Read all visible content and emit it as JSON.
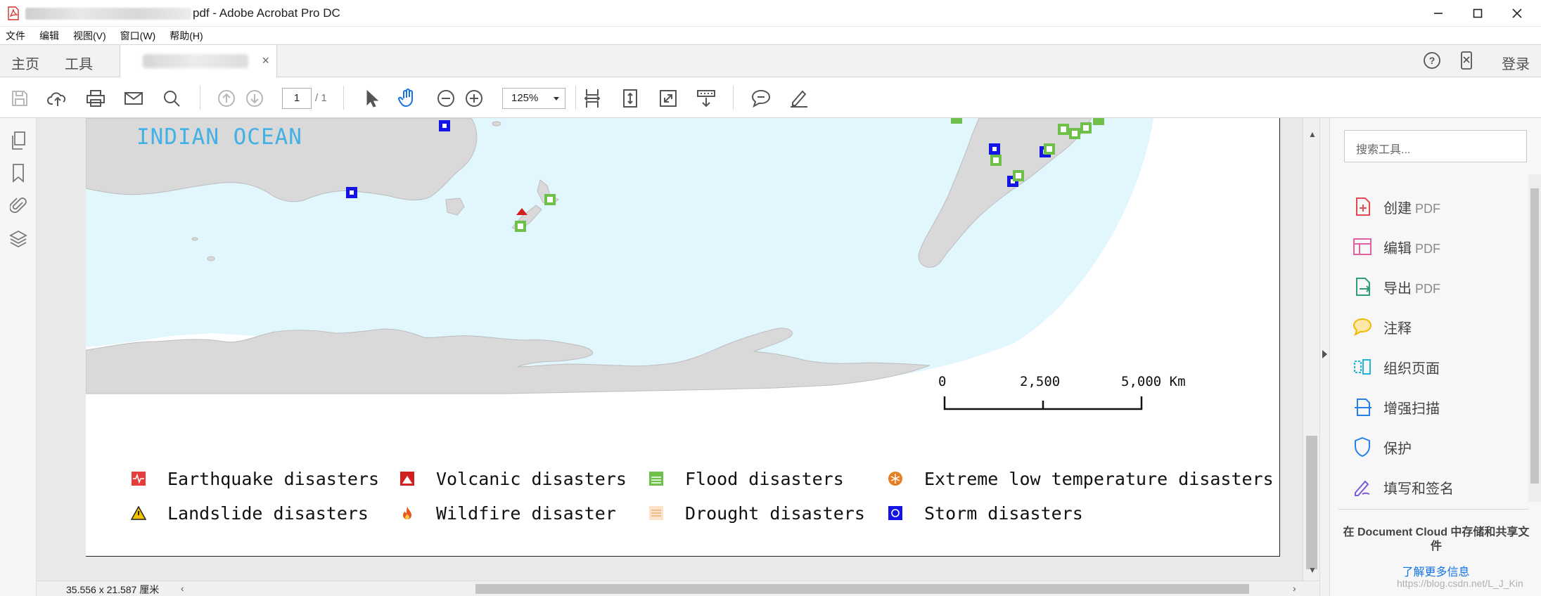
{
  "window": {
    "title": "pdf - Adobe Acrobat Pro DC",
    "controls": [
      "minimize",
      "maximize",
      "close"
    ]
  },
  "menu": [
    "文件",
    "编辑",
    "视图(V)",
    "窗口(W)",
    "帮助(H)"
  ],
  "tabs": {
    "home": "主页",
    "tools": "工具",
    "login": "登录"
  },
  "toolbar": {
    "page_current": "1",
    "page_total": "/ 1",
    "zoom": "125%"
  },
  "map": {
    "ocean_label": "INDIAN OCEAN",
    "scale_labels": [
      "0",
      "2,500",
      "5,000 Km"
    ],
    "colors": {
      "ocean": "#e2f6fd",
      "land": "#d9d9d9",
      "storm": "#1414e6",
      "flood": "#6fbf4b",
      "earthquake": "#e53c3c",
      "volcanic": "#d21f1f",
      "drought": "#f0b27a",
      "cold": "#e67e22"
    }
  },
  "legend": [
    {
      "label": "Earthquake disasters",
      "icon": "earthquake-icon"
    },
    {
      "label": "Volcanic disasters",
      "icon": "volcano-icon"
    },
    {
      "label": "Flood disasters",
      "icon": "flood-icon"
    },
    {
      "label": "Extreme low temperature disasters",
      "icon": "snowflake-icon"
    },
    {
      "label": "Landslide disasters",
      "icon": "landslide-icon"
    },
    {
      "label": "Wildfire disaster",
      "icon": "fire-icon"
    },
    {
      "label": "Drought disasters",
      "icon": "drought-icon"
    },
    {
      "label": "Storm disasters",
      "icon": "storm-icon"
    }
  ],
  "status": {
    "page_size": "35.556 x 21.587 厘米"
  },
  "right_pane": {
    "search_placeholder": "搜索工具...",
    "tools": [
      {
        "name": "创建",
        "suffix": " PDF",
        "icon": "create-pdf-icon"
      },
      {
        "name": "编辑",
        "suffix": " PDF",
        "icon": "edit-pdf-icon"
      },
      {
        "name": "导出",
        "suffix": " PDF",
        "icon": "export-pdf-icon"
      },
      {
        "name": "注释",
        "suffix": "",
        "icon": "comment-icon"
      },
      {
        "name": "组织页面",
        "suffix": "",
        "icon": "organize-pages-icon"
      },
      {
        "name": "增强扫描",
        "suffix": "",
        "icon": "enhance-scan-icon"
      },
      {
        "name": "保护",
        "suffix": "",
        "icon": "protect-icon"
      },
      {
        "name": "填写和签名",
        "suffix": "",
        "icon": "fill-sign-icon"
      }
    ],
    "cloud_text": "在 Document Cloud 中存储和共享文件",
    "learn_more": "了解更多信息"
  },
  "watermark": "https://blog.csdn.net/L_J_Kin"
}
